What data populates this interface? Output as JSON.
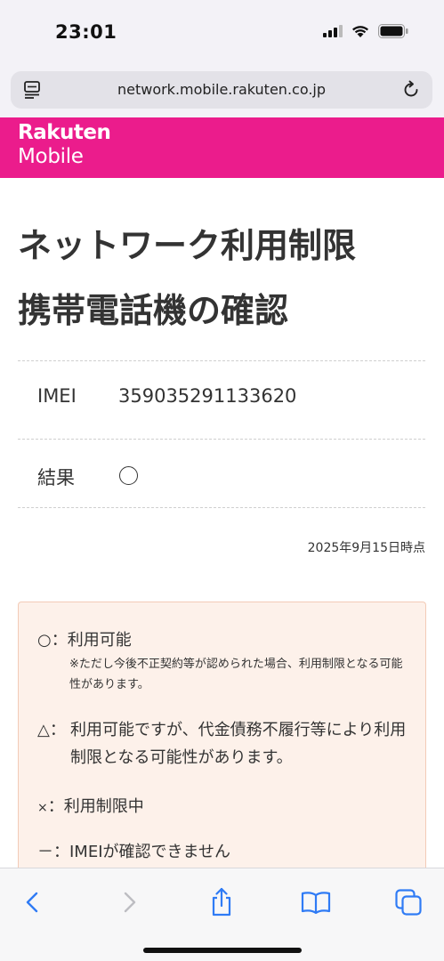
{
  "status": {
    "time": "23:01"
  },
  "browser": {
    "url": "network.mobile.rakuten.co.jp"
  },
  "brand": {
    "line1": "Rakuten",
    "line2": "Mobile",
    "color": "#eb1c8c"
  },
  "page": {
    "title_line1": "ネットワーク利用制限",
    "title_line2": "携帯電話機の確認"
  },
  "result_table": {
    "imei_label": "IMEI",
    "imei_value": "359035291133620",
    "result_label": "結果",
    "result_symbol": "circle-mark"
  },
  "timestamp": "2025年9月15日時点",
  "legend": {
    "available_symbol": "○",
    "available_text": "利用可能",
    "available_note": "※ただし今後不正契約等が認められた場合、利用制限となる可能性があります。",
    "caution_symbol": "△",
    "caution_text": "利用可能ですが、代金債務不履行等により利用制限となる可能性があります。",
    "restricted_symbol": "×",
    "restricted_text": "利用制限中",
    "unknown_symbol": "－",
    "unknown_text": "IMEIが確認できません"
  },
  "toolbar": {
    "icons": [
      "back-icon",
      "forward-icon",
      "share-icon",
      "bookmarks-icon",
      "tabs-icon"
    ],
    "accent": "#2f7bf5"
  }
}
